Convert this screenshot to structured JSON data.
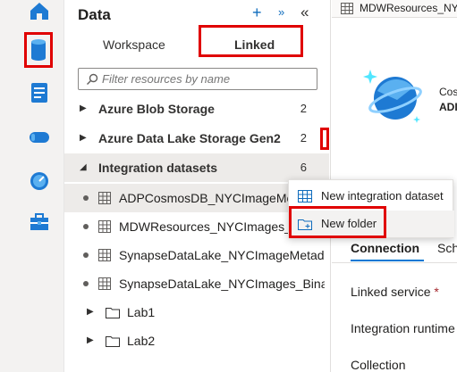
{
  "panel": {
    "title": "Data",
    "tabs": {
      "workspace": "Workspace",
      "linked": "Linked"
    },
    "search_placeholder": "Filter resources by name"
  },
  "tree": {
    "groups": [
      {
        "label": "Azure Blob Storage",
        "count": "2"
      },
      {
        "label": "Azure Data Lake Storage Gen2",
        "count": "2"
      },
      {
        "label": "Integration datasets",
        "count": "6"
      }
    ],
    "datasets": [
      {
        "label": "ADPCosmosDB_NYCImageMetad"
      },
      {
        "label": "MDWResources_NYCImages_Binar"
      },
      {
        "label": "SynapseDataLake_NYCImageMetada..."
      },
      {
        "label": "SynapseDataLake_NYCImages_Binary"
      }
    ],
    "folders": [
      {
        "label": "Lab1"
      },
      {
        "label": "Lab2"
      }
    ]
  },
  "context_menu": {
    "new_dataset": "New integration dataset",
    "new_folder": "New folder"
  },
  "main": {
    "tab_title": "MDWResources_NYCI",
    "cosmos_line1": "Cos",
    "cosmos_line2": "ADI",
    "tabs": {
      "connection": "Connection",
      "schema": "Sch"
    },
    "fields": {
      "linked_service": "Linked service",
      "required_mark": "*",
      "integration_runtime": "Integration runtime",
      "collection": "Collection"
    }
  },
  "colors": {
    "accent": "#0078d4",
    "highlight": "#e00000"
  }
}
